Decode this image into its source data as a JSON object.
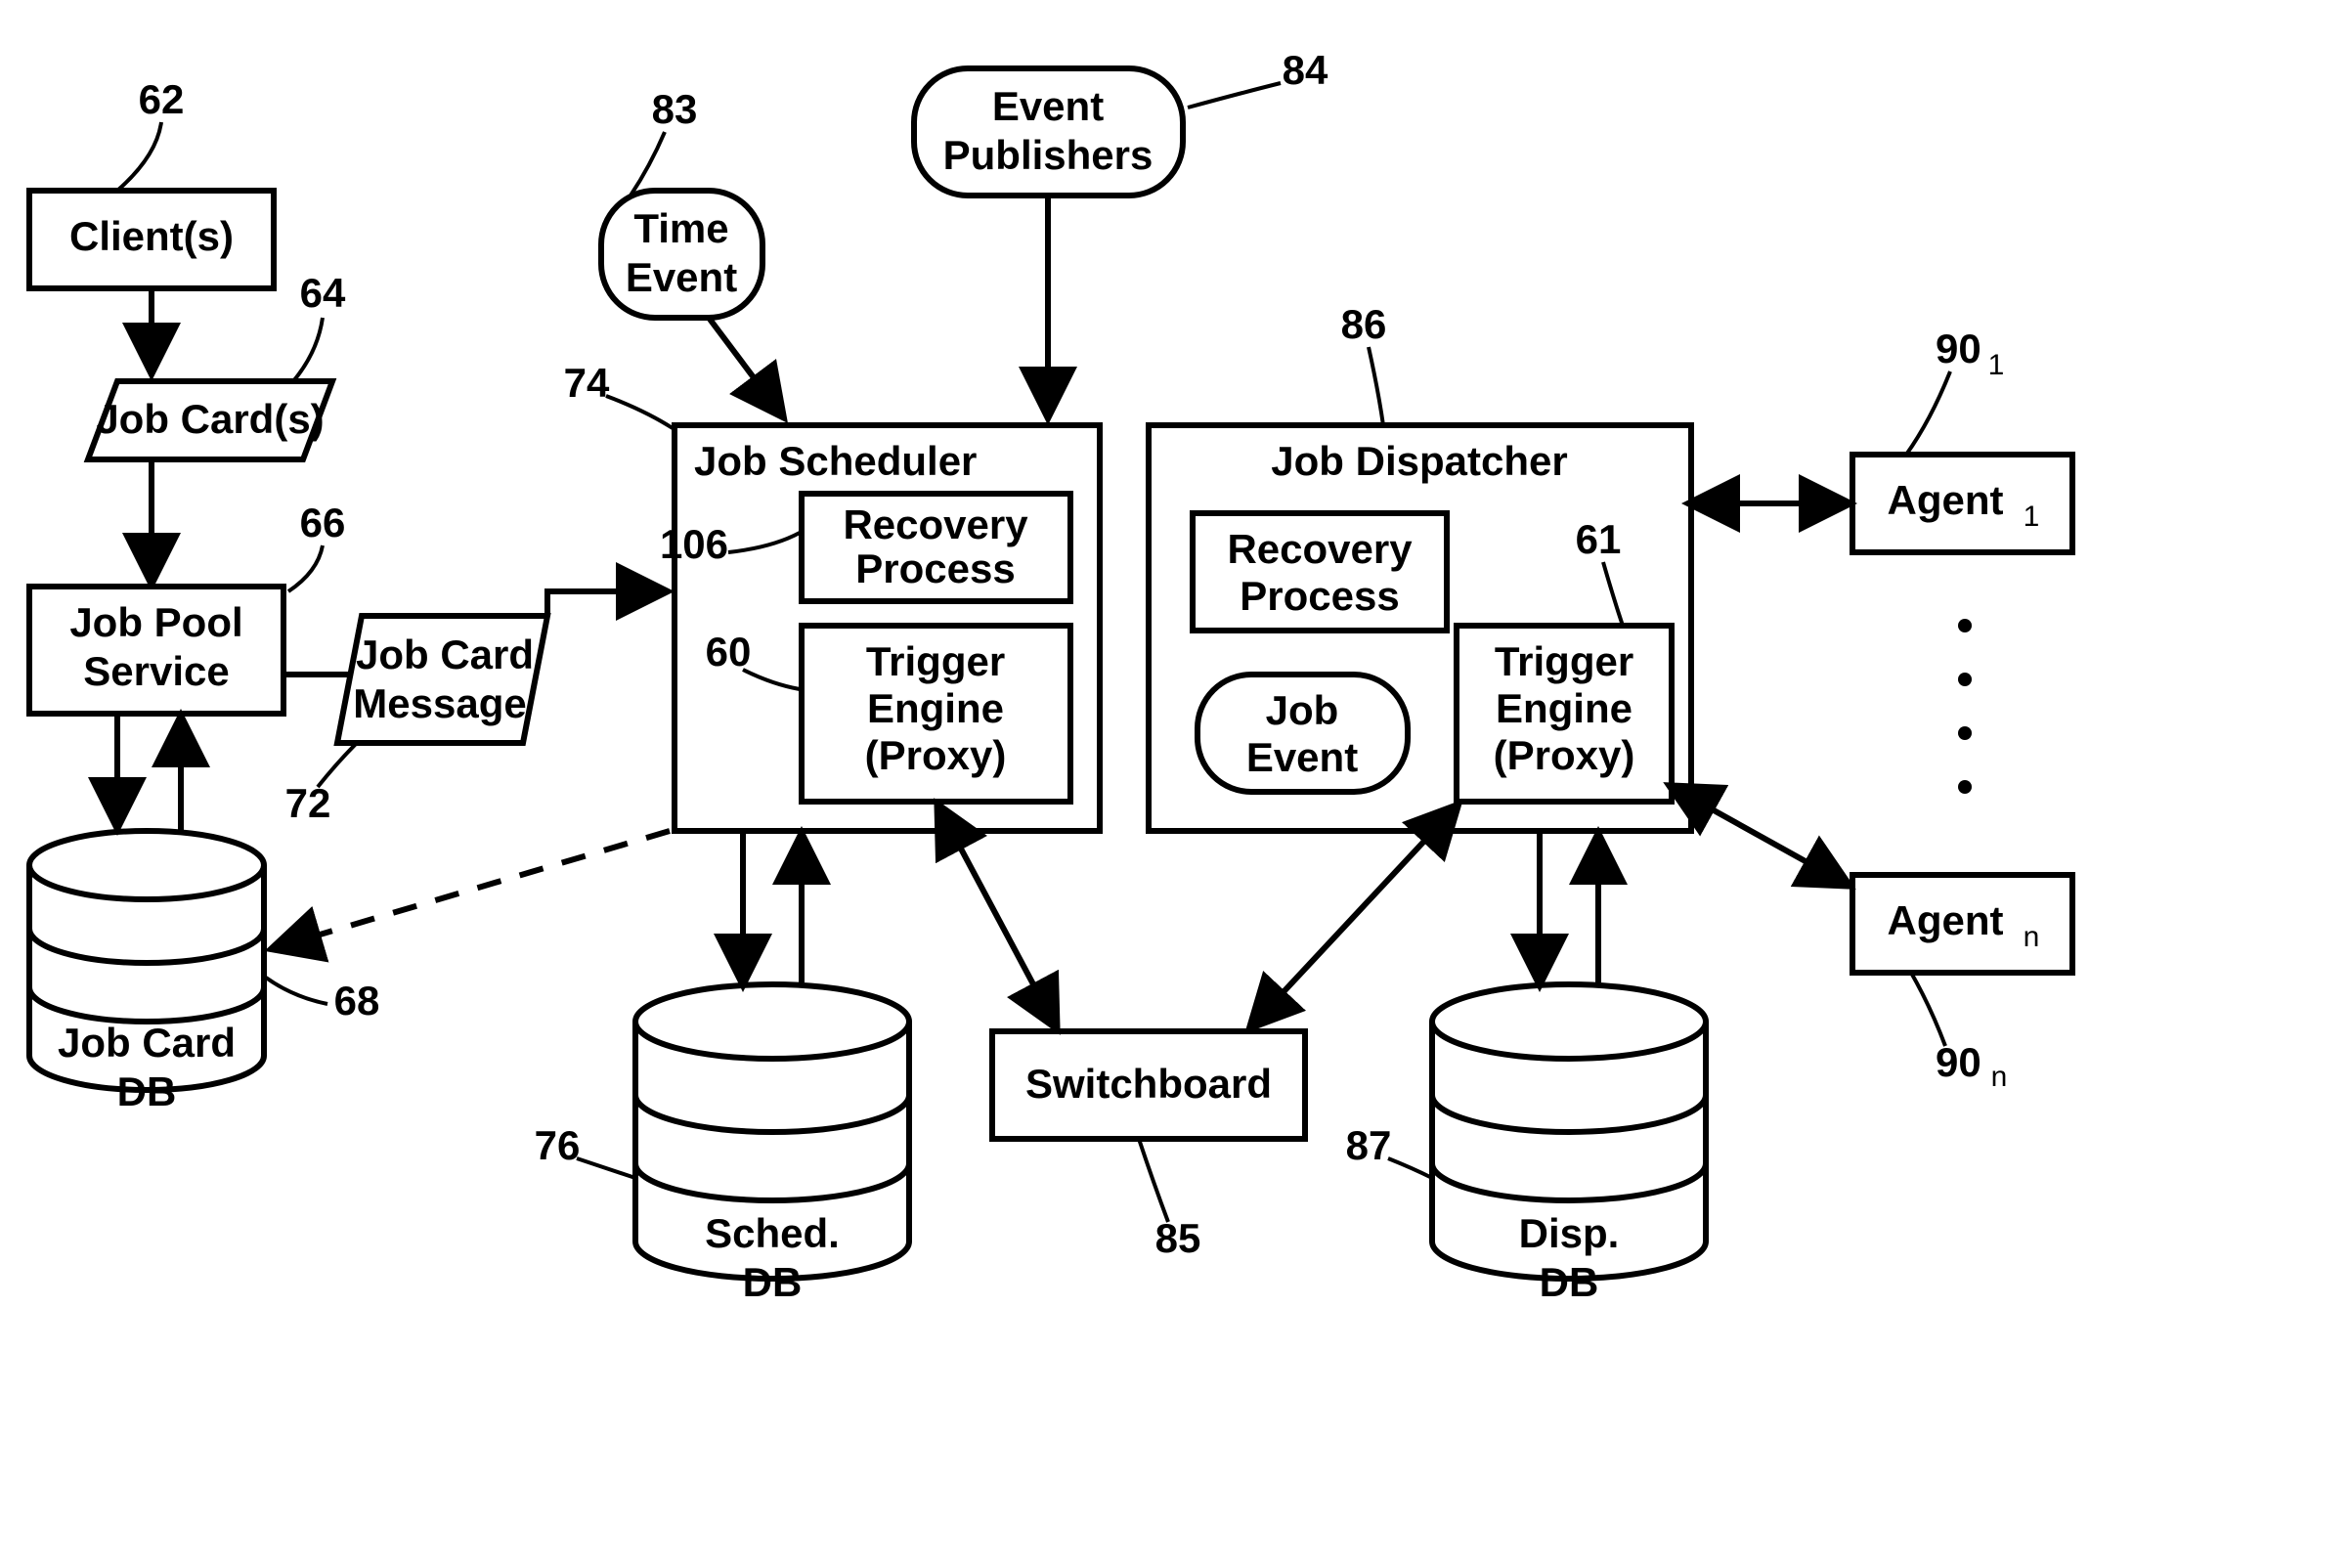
{
  "refs": {
    "clients": "62",
    "jobCards": "64",
    "jobPoolService": "66",
    "jobCardDB": "68",
    "jobCardMessage": "72",
    "jobScheduler": "74",
    "schedDB": "76",
    "timeEvent": "83",
    "eventPublishers": "84",
    "switchboard": "85",
    "jobDispatcher": "86",
    "dispDB": "87",
    "agent1": "90",
    "agent1sub": "1",
    "agentN": "90",
    "agentNsub": "n",
    "recoverySched": "106",
    "triggerSched": "60",
    "triggerDisp": "61"
  },
  "labels": {
    "clients": "Client(s)",
    "jobCards": "Job Card(s)",
    "jobPoolService1": "Job Pool",
    "jobPoolService2": "Service",
    "jobCardMessage1": "Job Card",
    "jobCardMessage2": "Message",
    "jobCardDB1": "Job Card",
    "jobCardDB2": "DB",
    "timeEvent1": "Time",
    "timeEvent2": "Event",
    "eventPublishers1": "Event",
    "eventPublishers2": "Publishers",
    "jobScheduler": "Job Scheduler",
    "recoverySched1": "Recovery",
    "recoverySched2": "Process",
    "triggerSched1": "Trigger",
    "triggerSched2": "Engine",
    "triggerSched3": "(Proxy)",
    "jobDispatcher": "Job Dispatcher",
    "recoveryDisp1": "Recovery",
    "recoveryDisp2": "Process",
    "jobEvent1": "Job",
    "jobEvent2": "Event",
    "triggerDisp1": "Trigger",
    "triggerDisp2": "Engine",
    "triggerDisp3": "(Proxy)",
    "switchboard": "Switchboard",
    "schedDB1": "Sched.",
    "schedDB2": "DB",
    "dispDB1": "Disp.",
    "dispDB2": "DB",
    "agent1": "Agent",
    "agent1sub": "1",
    "agentN": "Agent",
    "agentNsub": "n"
  }
}
